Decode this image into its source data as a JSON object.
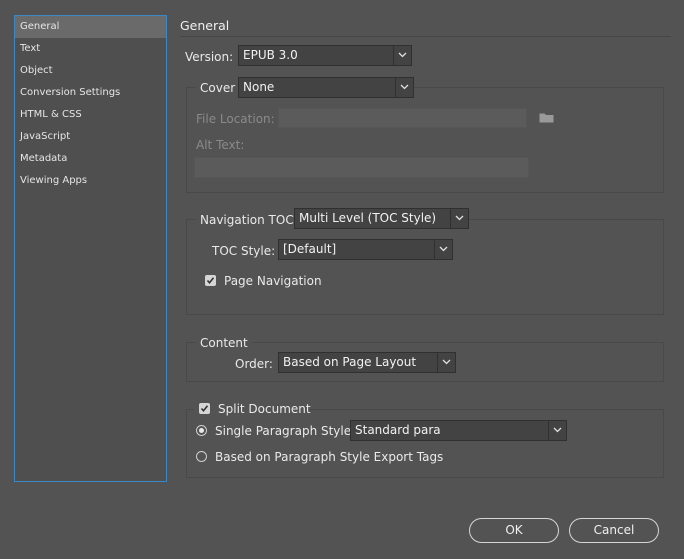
{
  "sidebar": {
    "items": [
      {
        "label": "General"
      },
      {
        "label": "Text"
      },
      {
        "label": "Object"
      },
      {
        "label": "Conversion Settings"
      },
      {
        "label": "HTML & CSS"
      },
      {
        "label": "JavaScript"
      },
      {
        "label": "Metadata"
      },
      {
        "label": "Viewing Apps"
      }
    ]
  },
  "general": {
    "title": "General",
    "version": {
      "label": "Version:",
      "value": "EPUB 3.0"
    },
    "cover": {
      "label": "Cover",
      "value": "None",
      "file_location_label": "File Location:",
      "alt_text_label": "Alt Text:"
    },
    "nav_toc": {
      "label": "Navigation TOC",
      "value": "Multi Level (TOC Style)",
      "toc_style_label": "TOC Style:",
      "toc_style_value": "[Default]",
      "page_navigation_label": "Page Navigation"
    },
    "content": {
      "label": "Content",
      "order_label": "Order:",
      "order_value": "Based on Page Layout"
    },
    "split": {
      "label": "Split Document",
      "single_label": "Single Paragraph Style",
      "single_value": "Standard para",
      "export_tags_label": "Based on Paragraph Style Export Tags"
    }
  },
  "buttons": {
    "ok": "OK",
    "cancel": "Cancel"
  }
}
